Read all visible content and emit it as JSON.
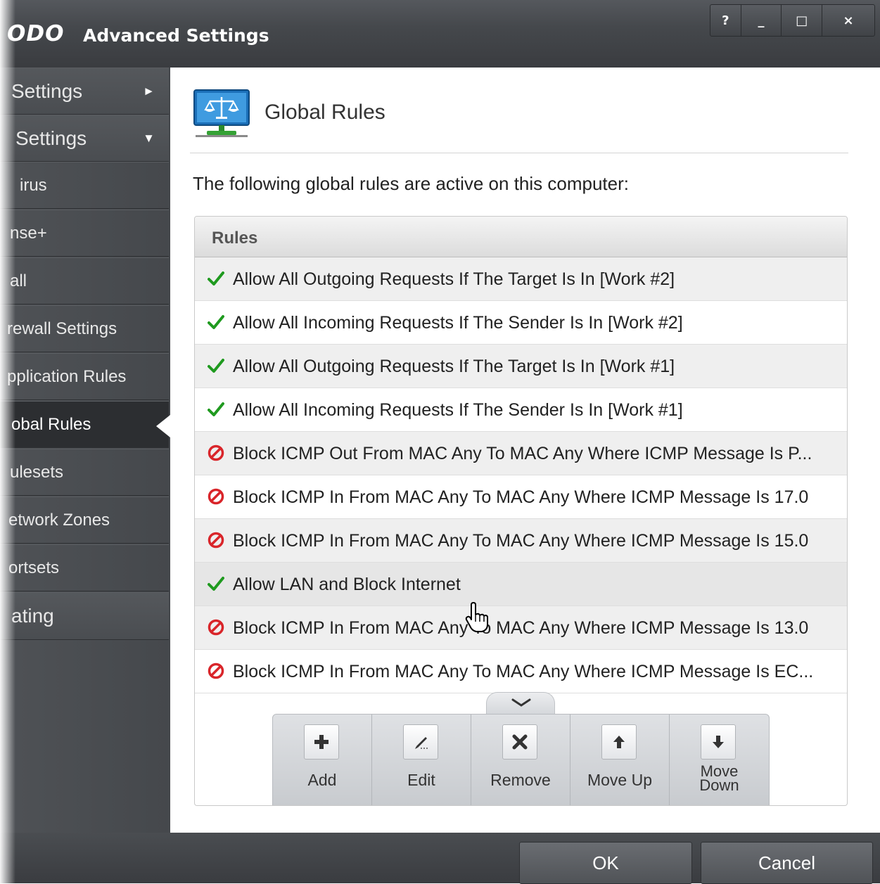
{
  "window": {
    "logo": "ODO",
    "title": "Advanced Settings",
    "controls": {
      "help": "?",
      "minimize": "_",
      "maximize": "□",
      "close": "×"
    }
  },
  "sidebar": {
    "items": [
      {
        "label": "Settings",
        "arrow": "►"
      },
      {
        "label": "Settings",
        "arrow": "▼"
      },
      {
        "label": "irus"
      },
      {
        "label": "nse+"
      },
      {
        "label": "all"
      },
      {
        "label": "rewall Settings"
      },
      {
        "label": "pplication Rules"
      },
      {
        "label": "obal Rules",
        "active": true
      },
      {
        "label": "ulesets"
      },
      {
        "label": "etwork Zones"
      },
      {
        "label": "ortsets"
      },
      {
        "label": "ating"
      }
    ]
  },
  "main": {
    "title": "Global Rules",
    "icon": "monitor-scales-icon",
    "intro": "The following global rules are active on this computer:",
    "rules_header": "Rules",
    "rules": [
      {
        "action": "allow",
        "text": "Allow All Outgoing Requests If The Target Is In [Work #2]"
      },
      {
        "action": "allow",
        "text": "Allow All Incoming Requests If The Sender Is In [Work #2]"
      },
      {
        "action": "allow",
        "text": "Allow All Outgoing Requests If The Target Is In [Work #1]"
      },
      {
        "action": "allow",
        "text": "Allow All Incoming Requests If The Sender Is In [Work #1]"
      },
      {
        "action": "block",
        "text": "Block ICMP Out From MAC Any To MAC Any Where ICMP Message Is P..."
      },
      {
        "action": "block",
        "text": "Block ICMP In From MAC Any To MAC Any Where ICMP Message Is 17.0"
      },
      {
        "action": "block",
        "text": "Block ICMP In From MAC Any To MAC Any Where ICMP Message Is 15.0"
      },
      {
        "action": "allow",
        "text": "Allow LAN and Block Internet",
        "selected": true
      },
      {
        "action": "block",
        "text": "Block ICMP In From MAC Any To MAC Any Where ICMP Message Is 13.0"
      },
      {
        "action": "block",
        "text": "Block ICMP In From MAC Any To MAC Any Where ICMP Message Is EC..."
      }
    ],
    "toolbar": {
      "add": "Add",
      "edit": "Edit",
      "remove": "Remove",
      "move_up": "Move Up",
      "move_down_line1": "Move",
      "move_down_line2": "Down"
    }
  },
  "footer": {
    "ok": "OK",
    "cancel": "Cancel"
  },
  "colors": {
    "allow_check": "#1f9a1f",
    "block_icon": "#d9252a",
    "chrome_dark": "#3a3d41"
  }
}
